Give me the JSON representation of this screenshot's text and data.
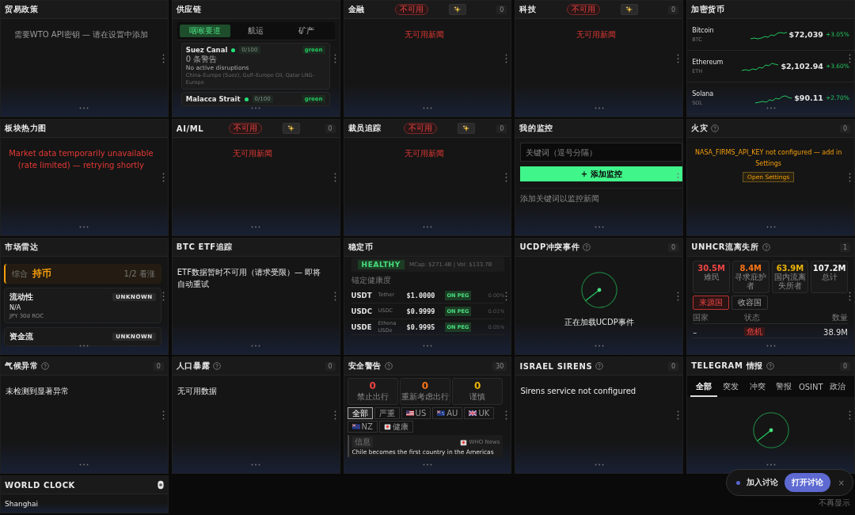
{
  "panels": [
    {
      "title": "贸易政策",
      "body": {
        "kind": "notice",
        "text": "需要WTO API密钥 — 请在设置中添加"
      }
    },
    {
      "title": "供应链",
      "body": {
        "kind": "supply",
        "tabs": [
          {
            "label": "咽喉要道",
            "selected": true
          },
          {
            "label": "航运",
            "selected": false
          },
          {
            "label": "矿产",
            "selected": false
          }
        ],
        "routes": [
          {
            "name": "Suez Canal",
            "color": "#22e07a",
            "score": "0/100",
            "status": "green",
            "alerts": "0 条警告",
            "note": "No active disruptions",
            "lanes": "China–Europe (Suez), Gulf–Europe Oil, Qatar LNG–Europe"
          },
          {
            "name": "Malacca Strait",
            "color": "#22e07a",
            "score": "0/100",
            "status": "green"
          }
        ]
      }
    },
    {
      "title": "金融",
      "status": "不可用",
      "ai": true,
      "count": "0",
      "body": {
        "kind": "error",
        "text": "无可用新闻"
      }
    },
    {
      "title": "科技",
      "status": "不可用",
      "ai": true,
      "count": "0",
      "body": {
        "kind": "error",
        "text": "无可用新闻"
      }
    },
    {
      "title": "加密货币",
      "body": {
        "kind": "crypto",
        "rows": [
          {
            "name": "Bitcoin",
            "symbol": "BTC",
            "price": "$72,039",
            "change": "+3.05%"
          },
          {
            "name": "Ethereum",
            "symbol": "ETH",
            "price": "$2,102.94",
            "change": "+3.60%"
          },
          {
            "name": "Solana",
            "symbol": "SOL",
            "price": "$90.11",
            "change": "+2.70%"
          }
        ]
      }
    },
    {
      "title": "板块热力图",
      "body": {
        "kind": "error",
        "text": "Market data temporarily unavailable (rate limited) — retrying shortly"
      }
    },
    {
      "title": "AI/ML",
      "status": "不可用",
      "ai": true,
      "count": "0",
      "body": {
        "kind": "error",
        "text": "无可用新闻"
      }
    },
    {
      "title": "裁员追踪",
      "status": "不可用",
      "ai": true,
      "count": "0",
      "body": {
        "kind": "error",
        "text": "无可用新闻"
      }
    },
    {
      "title": "我的监控",
      "body": {
        "kind": "watch",
        "placeholder": "关键词（逗号分隔）",
        "button": "+ 添加监控",
        "hint": "添加关键词以监控新闻"
      }
    },
    {
      "title": "火灾",
      "help": true,
      "count": "0",
      "body": {
        "kind": "config",
        "text": "NASA_FIRMS_API_KEY not configured — add in Settings",
        "button": "Open Settings"
      }
    },
    {
      "title": "市场雷达",
      "body": {
        "kind": "radar",
        "verdict": {
          "label": "综合",
          "value": "持币",
          "ratio": "1/2 看涨"
        },
        "signals": [
          {
            "name": "流动性",
            "status": "UNKNOWN",
            "value": "N/A",
            "note": "JPY 30d ROC"
          },
          {
            "name": "资金流",
            "status": "UNKNOWN"
          }
        ]
      }
    },
    {
      "title": "BTC ETF追踪",
      "body": {
        "kind": "text",
        "text": "ETF数据暂时不可用（请求受限）— 即将自动重试"
      }
    },
    {
      "title": "稳定币",
      "body": {
        "kind": "stable",
        "health": "HEALTHY",
        "summary": "MCap: $271.4B | Vol: $133.7B",
        "section": "锚定健康度",
        "coins": [
          {
            "symbol": "USDT",
            "name": "Tether",
            "price": "$1.0000",
            "status": "ON PEG",
            "deviation": "0.00%"
          },
          {
            "symbol": "USDC",
            "name": "USDC",
            "price": "$0.9999",
            "status": "ON PEG",
            "deviation": "0.01%"
          },
          {
            "symbol": "USDE",
            "name": "Ethena USDe",
            "price": "$0.9995",
            "status": "ON PEG",
            "deviation": "0.05%"
          }
        ]
      }
    },
    {
      "title": "UCDP冲突事件",
      "help": true,
      "count": "0",
      "body": {
        "kind": "loading",
        "text": "正在加载UCDP事件"
      }
    },
    {
      "title": "UNHCR流离失所",
      "help": true,
      "count": "1",
      "body": {
        "kind": "unhcr",
        "stats": [
          {
            "value": "30.5M",
            "label": "难民",
            "color": "#ef4444"
          },
          {
            "value": "8.4M",
            "label": "寻求庇护者",
            "color": "#f97316"
          },
          {
            "value": "63.9M",
            "label": "国内流离失所者",
            "color": "#eab308"
          },
          {
            "value": "107.2M",
            "label": "总计",
            "color": "#f5f5f5"
          }
        ],
        "tabs": [
          {
            "label": "来源国",
            "selected": true
          },
          {
            "label": "收容国",
            "selected": false
          }
        ],
        "columns": [
          "国家",
          "状态",
          "数量"
        ],
        "rows": [
          {
            "country": "–",
            "status": "危机",
            "count": "38.9M"
          }
        ]
      }
    },
    {
      "title": "气候异常",
      "help": true,
      "count": "0",
      "body": {
        "kind": "text",
        "text": "未检测到显著异常"
      }
    },
    {
      "title": "人口暴露",
      "help": true,
      "count": "0",
      "body": {
        "kind": "text",
        "text": "无可用数据"
      }
    },
    {
      "title": "安全警告",
      "help": true,
      "count": "30",
      "body": {
        "kind": "security",
        "stats": [
          {
            "value": "0",
            "label": "禁止出行",
            "color": "#ef4444"
          },
          {
            "value": "0",
            "label": "重新考虑出行",
            "color": "#f97316"
          },
          {
            "value": "0",
            "label": "谨慎",
            "color": "#eab308"
          }
        ],
        "filters": [
          {
            "kind": "plain",
            "label": "全部",
            "selected": true
          },
          {
            "kind": "plain",
            "label": "严重",
            "selected": false
          },
          {
            "kind": "us",
            "label": "US",
            "selected": false
          },
          {
            "kind": "au",
            "label": "AU",
            "selected": false
          },
          {
            "kind": "uk",
            "label": "UK",
            "selected": false
          },
          {
            "kind": "nz",
            "label": "NZ",
            "selected": false
          },
          {
            "kind": "health",
            "label": "健康",
            "selected": false
          }
        ],
        "item": {
          "level": "信息",
          "source": "WHO News",
          "title": "Chile becomes the first country in the Americas"
        }
      }
    },
    {
      "title": "ISRAEL SIRENS",
      "help": true,
      "count": "0",
      "body": {
        "kind": "text",
        "text": "Sirens service not configured"
      }
    },
    {
      "title": "TELEGRAM 情报",
      "help": true,
      "count": "0",
      "body": {
        "kind": "telegram",
        "tabs": [
          {
            "label": "全部",
            "selected": true
          },
          {
            "label": "突发",
            "selected": false
          },
          {
            "label": "冲突",
            "selected": false
          },
          {
            "label": "警报",
            "selected": false
          },
          {
            "label": "OSINT",
            "selected": false
          },
          {
            "label": "政治",
            "selected": false
          }
        ]
      }
    },
    {
      "title": "WORLD CLOCK",
      "toggle": true,
      "body": {
        "kind": "clock",
        "city": "Shanghai"
      }
    }
  ],
  "toast": {
    "text": "加入讨论",
    "button": "打开讨论",
    "close": "×",
    "dismiss": "不再显示"
  }
}
